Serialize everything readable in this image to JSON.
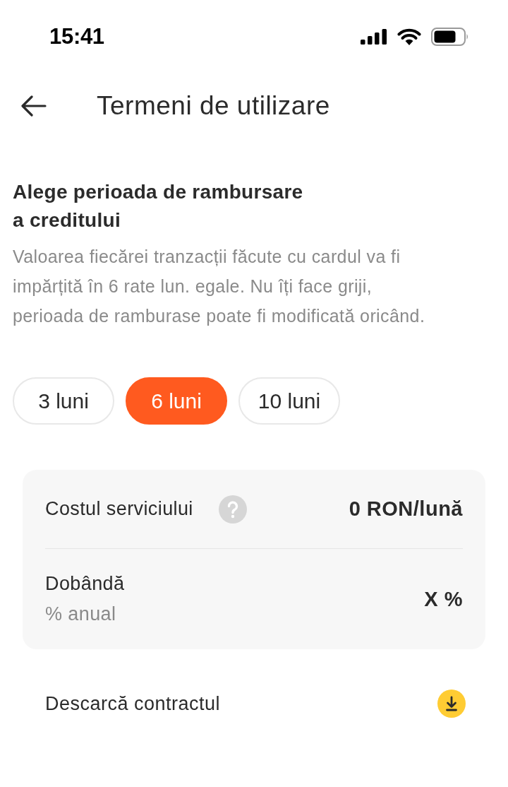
{
  "status_bar": {
    "time": "15:41"
  },
  "header": {
    "title": "Termeni de utilizare"
  },
  "section": {
    "heading": "Alege perioada de rambursare a creditului",
    "description": "Valoarea fiecărei tranzacții făcute cu cardul va fi impărțită în 6 rate lun. egale. Nu îți face griji, perioada de ramburase poate fi modificată oricând."
  },
  "periods": [
    {
      "label": "3 luni",
      "selected": false
    },
    {
      "label": "6 luni",
      "selected": true
    },
    {
      "label": "10 luni",
      "selected": false
    }
  ],
  "details": [
    {
      "label": "Costul serviciului",
      "help": true,
      "value": "0 RON/lună"
    },
    {
      "label": "Dobândă",
      "help": false,
      "sublabel": "% anual",
      "value": "X %"
    }
  ],
  "download": {
    "label": "Descarcă contractul"
  }
}
